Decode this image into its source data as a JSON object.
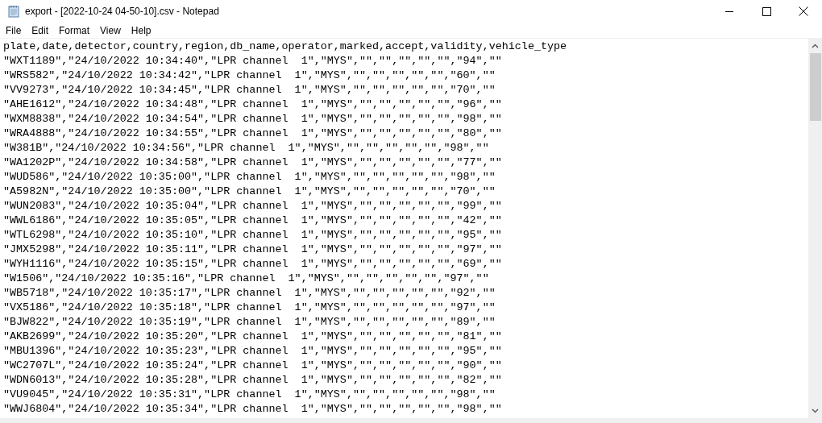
{
  "window": {
    "title": "export - [2022-10-24 04-50-10].csv - Notepad"
  },
  "menu": [
    "File",
    "Edit",
    "Format",
    "View",
    "Help"
  ],
  "lines": [
    "plate,date,detector,country,region,db_name,operator,marked,accept,validity,vehicle_type",
    "\"WXT1189\",\"24/10/2022 10:34:40\",\"LPR channel  1\",\"MYS\",\"\",\"\",\"\",\"\",\"\",\"94\",\"\"",
    "\"WRS582\",\"24/10/2022 10:34:42\",\"LPR channel  1\",\"MYS\",\"\",\"\",\"\",\"\",\"\",\"60\",\"\"",
    "\"VV9273\",\"24/10/2022 10:34:45\",\"LPR channel  1\",\"MYS\",\"\",\"\",\"\",\"\",\"\",\"70\",\"\"",
    "\"AHE1612\",\"24/10/2022 10:34:48\",\"LPR channel  1\",\"MYS\",\"\",\"\",\"\",\"\",\"\",\"96\",\"\"",
    "\"WXM8838\",\"24/10/2022 10:34:54\",\"LPR channel  1\",\"MYS\",\"\",\"\",\"\",\"\",\"\",\"98\",\"\"",
    "\"WRA4888\",\"24/10/2022 10:34:55\",\"LPR channel  1\",\"MYS\",\"\",\"\",\"\",\"\",\"\",\"80\",\"\"",
    "\"W381B\",\"24/10/2022 10:34:56\",\"LPR channel  1\",\"MYS\",\"\",\"\",\"\",\"\",\"\",\"98\",\"\"",
    "\"WA1202P\",\"24/10/2022 10:34:58\",\"LPR channel  1\",\"MYS\",\"\",\"\",\"\",\"\",\"\",\"77\",\"\"",
    "\"WUD586\",\"24/10/2022 10:35:00\",\"LPR channel  1\",\"MYS\",\"\",\"\",\"\",\"\",\"\",\"98\",\"\"",
    "\"A5982N\",\"24/10/2022 10:35:00\",\"LPR channel  1\",\"MYS\",\"\",\"\",\"\",\"\",\"\",\"70\",\"\"",
    "\"WUN2083\",\"24/10/2022 10:35:04\",\"LPR channel  1\",\"MYS\",\"\",\"\",\"\",\"\",\"\",\"99\",\"\"",
    "\"WWL6186\",\"24/10/2022 10:35:05\",\"LPR channel  1\",\"MYS\",\"\",\"\",\"\",\"\",\"\",\"42\",\"\"",
    "\"WTL6298\",\"24/10/2022 10:35:10\",\"LPR channel  1\",\"MYS\",\"\",\"\",\"\",\"\",\"\",\"95\",\"\"",
    "\"JMX5298\",\"24/10/2022 10:35:11\",\"LPR channel  1\",\"MYS\",\"\",\"\",\"\",\"\",\"\",\"97\",\"\"",
    "\"WYH1116\",\"24/10/2022 10:35:15\",\"LPR channel  1\",\"MYS\",\"\",\"\",\"\",\"\",\"\",\"69\",\"\"",
    "\"W1506\",\"24/10/2022 10:35:16\",\"LPR channel  1\",\"MYS\",\"\",\"\",\"\",\"\",\"\",\"97\",\"\"",
    "\"WB5718\",\"24/10/2022 10:35:17\",\"LPR channel  1\",\"MYS\",\"\",\"\",\"\",\"\",\"\",\"92\",\"\"",
    "\"VX5186\",\"24/10/2022 10:35:18\",\"LPR channel  1\",\"MYS\",\"\",\"\",\"\",\"\",\"\",\"97\",\"\"",
    "\"BJW822\",\"24/10/2022 10:35:19\",\"LPR channel  1\",\"MYS\",\"\",\"\",\"\",\"\",\"\",\"89\",\"\"",
    "\"AKB2699\",\"24/10/2022 10:35:20\",\"LPR channel  1\",\"MYS\",\"\",\"\",\"\",\"\",\"\",\"81\",\"\"",
    "\"MBU1396\",\"24/10/2022 10:35:23\",\"LPR channel  1\",\"MYS\",\"\",\"\",\"\",\"\",\"\",\"95\",\"\"",
    "\"WC2707L\",\"24/10/2022 10:35:24\",\"LPR channel  1\",\"MYS\",\"\",\"\",\"\",\"\",\"\",\"90\",\"\"",
    "\"WDN6013\",\"24/10/2022 10:35:28\",\"LPR channel  1\",\"MYS\",\"\",\"\",\"\",\"\",\"\",\"82\",\"\"",
    "\"VU9045\",\"24/10/2022 10:35:31\",\"LPR channel  1\",\"MYS\",\"\",\"\",\"\",\"\",\"\",\"98\",\"\"",
    "\"WWJ6804\",\"24/10/2022 10:35:34\",\"LPR channel  1\",\"MYS\",\"\",\"\",\"\",\"\",\"\",\"98\",\"\""
  ]
}
